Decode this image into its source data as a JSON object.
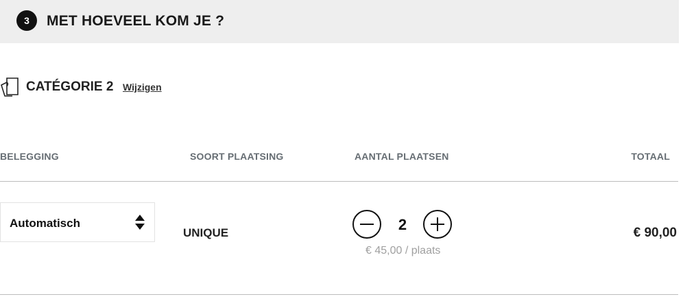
{
  "step": {
    "number": "3",
    "title": "MET HOEVEEL KOM JE ?"
  },
  "category": {
    "icon": "ticket-icon",
    "label": "CATÉGORIE 2",
    "change_link": "Wijzigen"
  },
  "table": {
    "headers": [
      "BELEGGING",
      "SOORT PLAATSING",
      "AANTAL PLAATSEN",
      "TOTAAL"
    ],
    "row": {
      "belegging_selected": "Automatisch",
      "soort_plaatsing": "UNIQUE",
      "quantity": "2",
      "unit_price": "€ 45,00 / plaats",
      "total": "€ 90,00"
    }
  },
  "icons": {
    "select": "sort-arrows-icon",
    "decrement": "minus-icon",
    "increment": "plus-icon"
  },
  "colors": {
    "header_bg": "#eeeeee",
    "badge_bg": "#111111",
    "header_text": "#666d73",
    "muted_text": "#a0a0a0"
  }
}
